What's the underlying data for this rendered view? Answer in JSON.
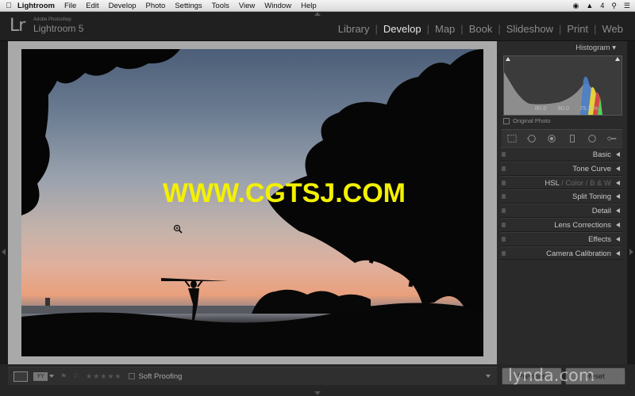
{
  "menubar": {
    "app_name": "Lightroom",
    "items": [
      "File",
      "Edit",
      "Develop",
      "Photo",
      "Settings",
      "Tools",
      "View",
      "Window",
      "Help"
    ],
    "status_number": "4"
  },
  "identity": {
    "logo": "Lr",
    "subtitle_small": "Adobe Photoshop",
    "subtitle": "Lightroom 5"
  },
  "modules": [
    {
      "label": "Library",
      "active": false
    },
    {
      "label": "Develop",
      "active": true
    },
    {
      "label": "Map",
      "active": false
    },
    {
      "label": "Book",
      "active": false
    },
    {
      "label": "Slideshow",
      "active": false
    },
    {
      "label": "Print",
      "active": false
    },
    {
      "label": "Web",
      "active": false
    }
  ],
  "watermark": "WWW.CGTSJ.COM",
  "histogram": {
    "title": "Histogram",
    "r_label": "R",
    "r_value": "80.0",
    "g_label": "G",
    "g_value": "80.0",
    "b_label": "B",
    "b_value": "75.3",
    "unit": "%",
    "original_photo": "Original Photo"
  },
  "panels": [
    {
      "label": "Basic"
    },
    {
      "label": "Tone Curve"
    },
    {
      "label": "HSL",
      "extra1": " / Color / ",
      "extra2": "B & W"
    },
    {
      "label": "Split Toning"
    },
    {
      "label": "Detail"
    },
    {
      "label": "Lens Corrections"
    },
    {
      "label": "Effects"
    },
    {
      "label": "Camera Calibration"
    }
  ],
  "toolbar": {
    "compare_label": "YY",
    "soft_proofing": "Soft Proofing",
    "stars": "★★★★★"
  },
  "buttons": {
    "previous": "Previous",
    "reset": "Reset"
  },
  "branding": "lynda.com"
}
